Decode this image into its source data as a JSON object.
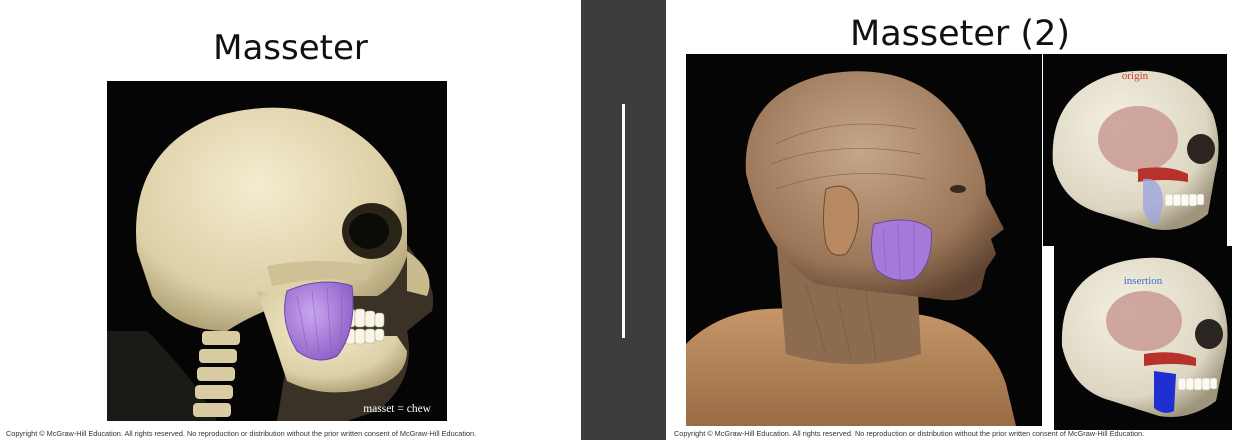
{
  "colors": {
    "viewer_background": "#3d3d3d",
    "slide_background": "#ffffff",
    "masseter_muscle": "#a57ad8",
    "bone": "#e6dcb8",
    "origin_label": "#d43a2b",
    "insertion_label": "#3a6fc8"
  },
  "slide_left": {
    "title": "Masseter",
    "image_caption": "masset = chew",
    "image_icon": "skull-with-masseter-illustration",
    "copyright": "Copyright © McGraw-Hill Education. All rights reserved. No reproduction or distribution without the prior written consent of McGraw-Hill Education."
  },
  "slide_right": {
    "title": "Masseter (2)",
    "main_image_icon": "dissected-head-illustration",
    "origin_panel": {
      "label": "origin",
      "icon": "skull-origin-illustration"
    },
    "insertion_panel": {
      "label": "insertion",
      "icon": "skull-insertion-illustration"
    },
    "copyright": "Copyright © McGraw-Hill Education. All rights reserved. No reproduction or distribution without the prior written consent of McGraw-Hill Education."
  }
}
